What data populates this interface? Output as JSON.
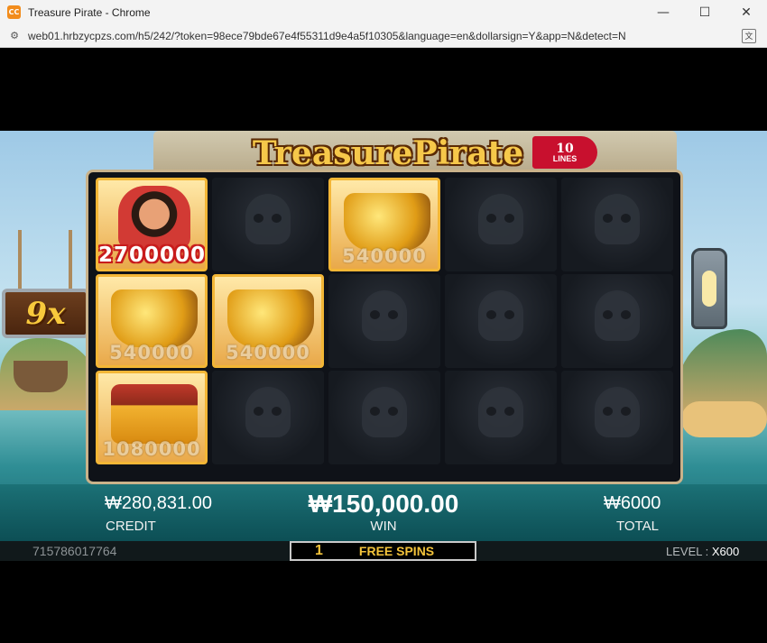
{
  "window": {
    "title": "Treasure Pirate - Chrome",
    "app_icon_text": "CC",
    "controls": {
      "minimize": "—",
      "maximize": "☐",
      "close": "✕"
    }
  },
  "address_bar": {
    "url": "web01.hrbzycpzs.com/h5/242/?token=98ece79bde67e4f55311d9e4a5f10305&language=en&dollarsign=Y&app=N&detect=N",
    "site_icon": "settings-icon",
    "translate_icon": "translate-icon"
  },
  "game": {
    "logo_text": "TreasurePirate",
    "lines_num": "10",
    "lines_label": "LINES",
    "multiplier": "9x",
    "grid": [
      [
        {
          "type": "pirate",
          "value": "2700000",
          "hot": true
        },
        {
          "type": "empty"
        },
        {
          "type": "chest",
          "value": "540000"
        },
        {
          "type": "empty"
        },
        {
          "type": "empty"
        }
      ],
      [
        {
          "type": "gold",
          "value": "540000"
        },
        {
          "type": "gold",
          "value": "540000"
        },
        {
          "type": "empty"
        },
        {
          "type": "empty"
        },
        {
          "type": "empty"
        }
      ],
      [
        {
          "type": "barrel",
          "value": "1080000"
        },
        {
          "type": "empty"
        },
        {
          "type": "empty"
        },
        {
          "type": "empty"
        },
        {
          "type": "empty"
        }
      ]
    ],
    "hud": {
      "credit_value": "₩280,831.00",
      "credit_label": "CREDIT",
      "win_value": "₩150,000.00",
      "win_label": "WIN",
      "total_value": "₩6000",
      "total_label": "TOTAL"
    },
    "bottom": {
      "round_id": "715786017764",
      "free_spins_count": "1",
      "free_spins_label": "FREE SPINS",
      "level_label": "LEVEL : ",
      "level_value": "X600"
    }
  }
}
